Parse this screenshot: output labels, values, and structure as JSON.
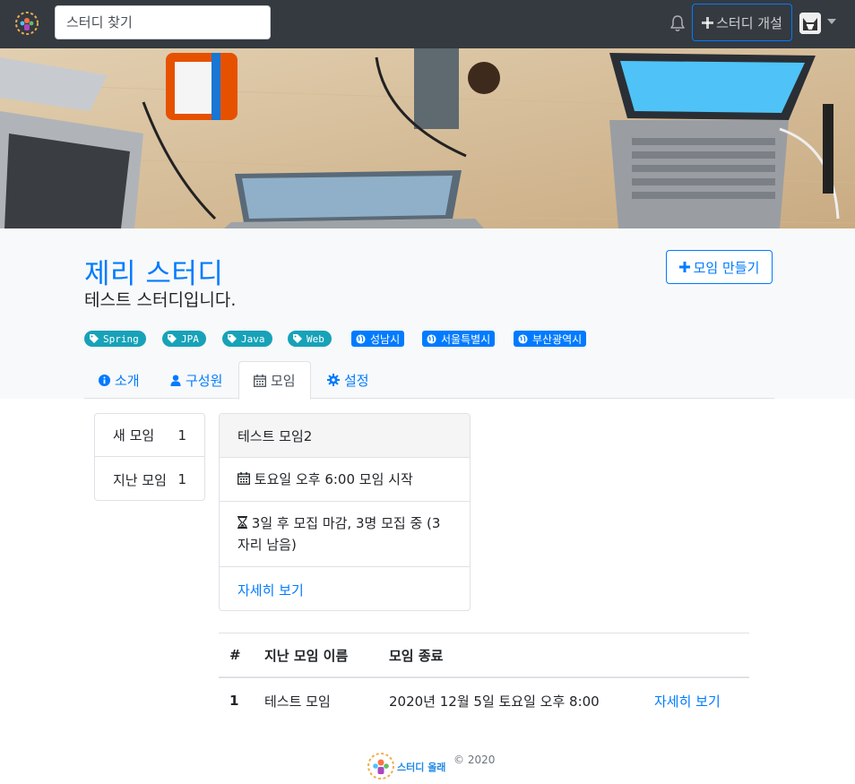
{
  "nav": {
    "search_placeholder": "스터디 찾기",
    "open_study_label": "스터디 개설"
  },
  "study": {
    "title": "제리 스터디",
    "description": "테스트 스터디입니다.",
    "new_event_label": "모임 만들기",
    "tags": [
      "Spring",
      "JPA",
      "Java",
      "Web"
    ],
    "zones": [
      "성남시",
      "서울특별시",
      "부산광역시"
    ]
  },
  "tabs": [
    {
      "label": "소개",
      "icon": "info-circle-icon"
    },
    {
      "label": "구성원",
      "icon": "user-icon"
    },
    {
      "label": "모임",
      "icon": "calendar-icon"
    },
    {
      "label": "설정",
      "icon": "gear-icon"
    }
  ],
  "side_menu": [
    {
      "label": "새 모임",
      "count": "1"
    },
    {
      "label": "지난 모임",
      "count": "1"
    }
  ],
  "event_card": {
    "title": "테스트 모임2",
    "start": "토요일 오후 6:00 모임 시작",
    "recruit": "3일 후 모집 마감, 3명 모집 중 (3 자리 남음)",
    "link": "자세히 보기"
  },
  "past_table": {
    "headers": [
      "#",
      "지난 모임 이름",
      "모임 종료",
      ""
    ],
    "rows": [
      {
        "num": "1",
        "name": "테스트 모임",
        "end": "2020년 12월 5일 토요일 오후 8:00",
        "link": "자세히 보기"
      }
    ]
  },
  "footer": {
    "logo_text": "스터디 올래",
    "copyright": "© 2020"
  },
  "colors": {
    "navbar": "#343a40",
    "primary": "#007bff",
    "tag": "#17a2b8"
  }
}
